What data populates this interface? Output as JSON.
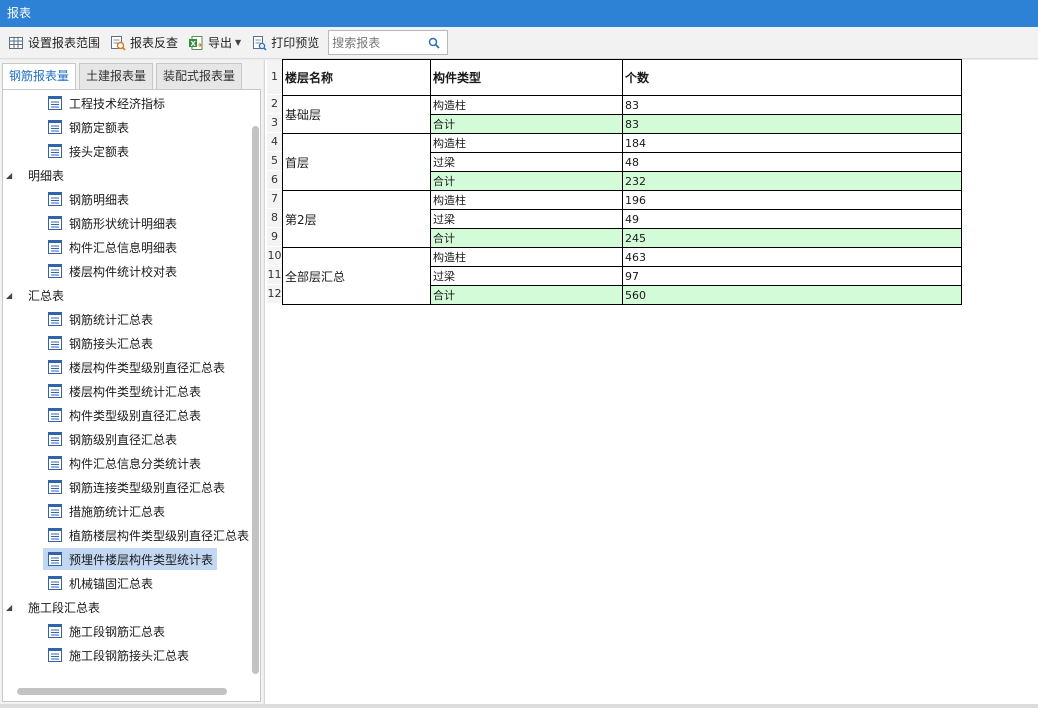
{
  "window": {
    "title": "报表"
  },
  "toolbar": {
    "set_range": "设置报表范围",
    "reverse_check": "报表反查",
    "export": "导出",
    "print_preview": "打印预览",
    "search_placeholder": "搜索报表"
  },
  "tabs": [
    {
      "label": "钢筋报表量",
      "active": true
    },
    {
      "label": "土建报表量",
      "active": false
    },
    {
      "label": "装配式报表量",
      "active": false
    }
  ],
  "tree": {
    "top_items": [
      "工程技术经济指标",
      "钢筋定额表",
      "接头定额表"
    ],
    "group_detail": "明细表",
    "detail_items": [
      "钢筋明细表",
      "钢筋形状统计明细表",
      "构件汇总信息明细表",
      "楼层构件统计校对表"
    ],
    "group_summary": "汇总表",
    "summary_items": [
      "钢筋统计汇总表",
      "钢筋接头汇总表",
      "楼层构件类型级别直径汇总表",
      "楼层构件类型统计汇总表",
      "构件类型级别直径汇总表",
      "钢筋级别直径汇总表",
      "构件汇总信息分类统计表",
      "钢筋连接类型级别直径汇总表",
      "措施筋统计汇总表",
      "植筋楼层构件类型级别直径汇总表",
      "预埋件楼层构件类型统计表",
      "机械锚固汇总表"
    ],
    "selected": "预埋件楼层构件类型统计表",
    "group_stage": "施工段汇总表",
    "stage_items": [
      "施工段钢筋汇总表",
      "施工段钢筋接头汇总表"
    ]
  },
  "report": {
    "headers": [
      "楼层名称",
      "构件类型",
      "个数"
    ],
    "row_numbers": [
      "1",
      "2",
      "3",
      "4",
      "5",
      "6",
      "7",
      "8",
      "9",
      "10",
      "11",
      "12"
    ],
    "floors": [
      {
        "name": "基础层",
        "rows": [
          {
            "type": "构造柱",
            "count": "83"
          },
          {
            "type": "合计",
            "count": "83"
          }
        ]
      },
      {
        "name": "首层",
        "rows": [
          {
            "type": "构造柱",
            "count": "184"
          },
          {
            "type": "过梁",
            "count": "48"
          },
          {
            "type": "合计",
            "count": "232"
          }
        ]
      },
      {
        "name": "第2层",
        "rows": [
          {
            "type": "构造柱",
            "count": "196"
          },
          {
            "type": "过梁",
            "count": "49"
          },
          {
            "type": "合计",
            "count": "245"
          }
        ]
      },
      {
        "name": "全部层汇总",
        "rows": [
          {
            "type": "构造柱",
            "count": "463"
          },
          {
            "type": "过梁",
            "count": "97"
          },
          {
            "type": "合计",
            "count": "560"
          }
        ]
      }
    ]
  },
  "colors": {
    "titlebar": "#2e82d6",
    "total_row": "#d3fbd8",
    "selected_item": "#c2d8f2",
    "active_tab_text": "#1e6fc4"
  }
}
